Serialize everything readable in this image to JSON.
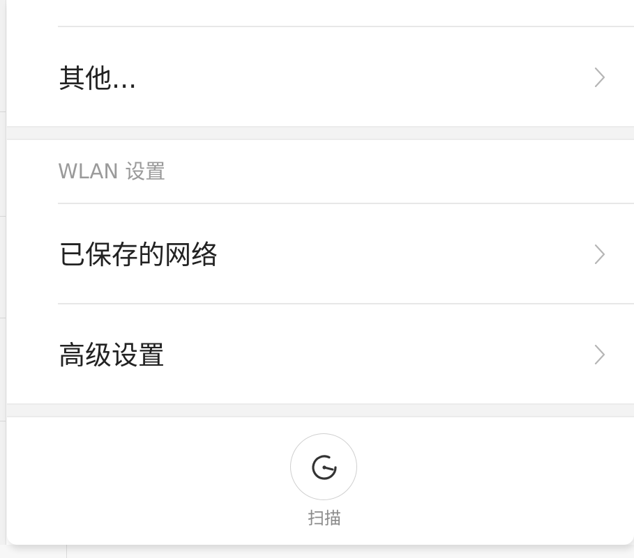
{
  "other": {
    "label": "其他..."
  },
  "wlan_section": {
    "header": "WLAN 设置",
    "items": [
      {
        "label": "已保存的网络"
      },
      {
        "label": "高级设置"
      }
    ]
  },
  "scan": {
    "label": "扫描"
  },
  "icons": {
    "row_chevron": "chevron-right-icon",
    "scan": "scan-gauge-icon"
  },
  "colors": {
    "background": "#ffffff",
    "section_gap": "#f3f3f3",
    "divider": "#e7e7e7",
    "primary_text": "#222222",
    "secondary_text": "#9a9a9a",
    "chevron": "#b5b5b5"
  }
}
